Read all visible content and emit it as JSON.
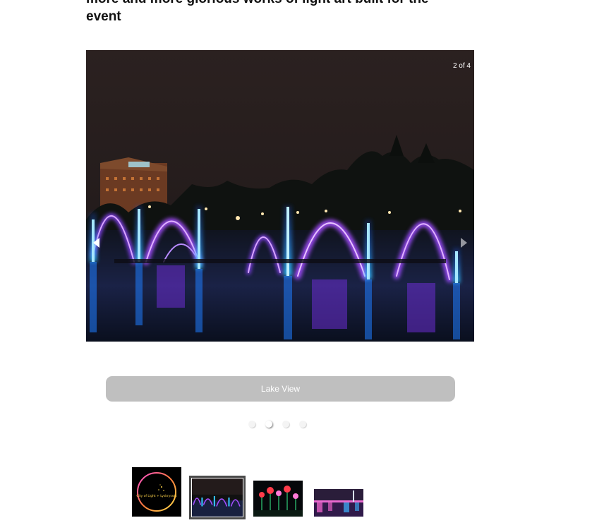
{
  "heading": {
    "text": "more and more glorious works of light art built for the event"
  },
  "slideshow": {
    "counter": "2 of 4",
    "caption": "Lake View",
    "current_slide": 2,
    "total_slides": 4
  },
  "thumbnails": {
    "logo_text": "City of Light + Lyskrysset",
    "items": [
      {
        "subject": "city of light logo"
      },
      {
        "subject": "lake fountains"
      },
      {
        "subject": "light flowers"
      },
      {
        "subject": "illuminated river bridge"
      }
    ]
  },
  "colors": {
    "caption_bar": "#bfbfbf",
    "fountain_blue": "#1ea8ff",
    "fountain_violet": "#9b4dff",
    "sky": "#2b2120"
  }
}
